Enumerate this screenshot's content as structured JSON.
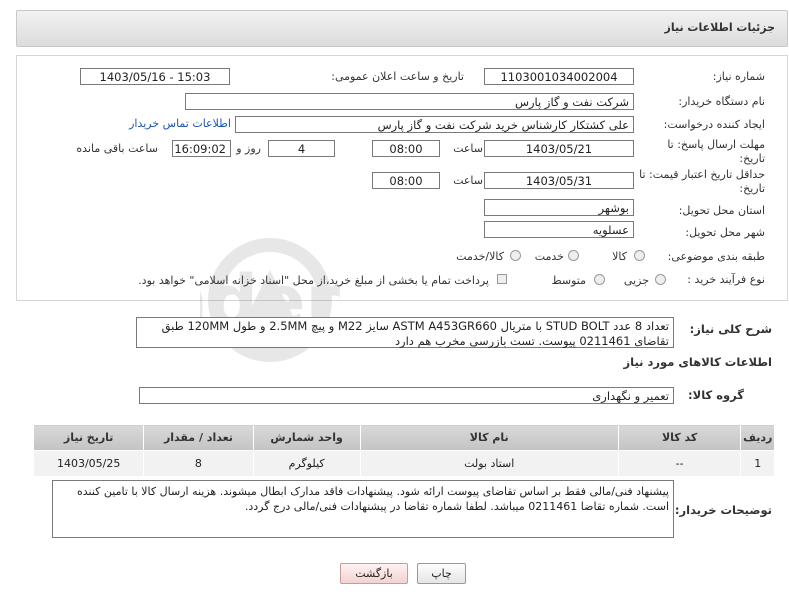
{
  "header": {
    "title": "جزئیات اطلاعات نیاز"
  },
  "form": {
    "need_number_label": "شماره نیاز:",
    "need_number": "1103001034002004",
    "announce_label": "تاریخ و ساعت اعلان عمومی:",
    "announce_value": "1403/05/16 - 15:03",
    "buyer_org_label": "نام دستگاه خریدار:",
    "buyer_org": "شرکت نفت و گاز پارس",
    "creator_label": "ایجاد کننده درخواست:",
    "creator": "علی کشتکار کارشناس خرید شرکت نفت و گاز پارس",
    "contact_link": "اطلاعات تماس خریدار",
    "deadline_label_1": "مهلت ارسال پاسخ: تا",
    "deadline_label_2": "تاریخ:",
    "deadline_date": "1403/05/21",
    "time_label": "ساعت",
    "deadline_time": "08:00",
    "days_value": "4",
    "days_label": "روز و",
    "remaining_time": "16:09:02",
    "remaining_label": "ساعت باقی مانده",
    "validity_label_1": "حداقل تاریخ اعتبار قیمت: تا",
    "validity_label_2": "تاریخ:",
    "validity_date": "1403/05/31",
    "validity_time": "08:00",
    "province_label": "استان محل تحویل:",
    "province": "بوشهر",
    "city_label": "شهر محل تحویل:",
    "city": "عسلویه",
    "category_label": "طبقه بندی موضوعی:",
    "category_options": [
      "کالا",
      "خدمت",
      "کالا/خدمت"
    ],
    "process_label": "نوع فرآیند خرید :",
    "process_options": [
      "جزیی",
      "متوسط"
    ],
    "payment_text": "پرداخت تمام یا بخشی از مبلغ خرید،از محل \"اسناد خزانه اسلامی\" خواهد بود."
  },
  "description": {
    "label": "شرح کلی نیاز:",
    "text": "تعداد 8 عدد STUD BOLT با متریال ASTM A453GR660 سایز M22 و پیچ 2.5MM و طول 120MM طبق تقاضای 0211461 پیوست. تست بازرسی مخرب هم دارد"
  },
  "goods_info": {
    "title": "اطلاعات کالاهای مورد نیاز",
    "group_label": "گروه کالا:",
    "group_value": "تعمیر و نگهداری"
  },
  "table": {
    "headers": [
      "ردیف",
      "کد کالا",
      "نام کالا",
      "واحد شمارش",
      "تعداد / مقدار",
      "تاریخ نیاز"
    ],
    "rows": [
      [
        "1",
        "--",
        "استاد بولت",
        "کیلوگرم",
        "8",
        "1403/05/25"
      ]
    ]
  },
  "notes": {
    "label": "توضیحات خریدار:",
    "text": "پیشنهاد فنی/مالی فقط بر اساس تقاضای پیوست ارائه شود. پیشنهادات فاقد مدارک ابطال میشوند. هزینه ارسال کالا با تامین کننده است. شماره تقاضا 0211461 میباشد. لطفا شماره تقاضا در پیشنهادات فنی/مالی درج گردد."
  },
  "buttons": {
    "print": "چاپ",
    "back": "بازگشت"
  },
  "colors": {
    "link": "#1a55b4",
    "header_bg": "#e2e2e2",
    "table_header": "#cfcfcf"
  }
}
